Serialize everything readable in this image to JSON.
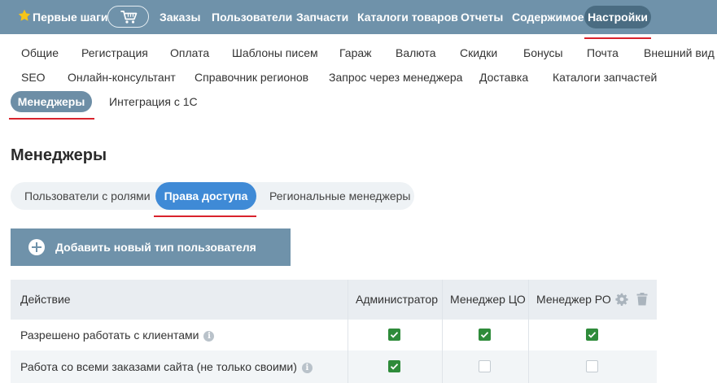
{
  "topnav": {
    "items": [
      {
        "label": "Первые шаги"
      },
      {
        "label": "Заказы"
      },
      {
        "label": "Пользователи"
      },
      {
        "label": "Запчасти"
      },
      {
        "label": "Каталоги товаров"
      },
      {
        "label": "Отчеты"
      },
      {
        "label": "Содержимое"
      },
      {
        "label": "Настройки"
      }
    ],
    "icons": [
      "star-icon",
      "cart-icon"
    ]
  },
  "settings_tabs": [
    {
      "label": "Общие"
    },
    {
      "label": "Регистрация"
    },
    {
      "label": "Оплата"
    },
    {
      "label": "Шаблоны писем"
    },
    {
      "label": "Гараж"
    },
    {
      "label": "Валюта"
    },
    {
      "label": "Скидки"
    },
    {
      "label": "Бонусы"
    },
    {
      "label": "Почта"
    },
    {
      "label": "Внешний вид"
    },
    {
      "label": "SEO"
    },
    {
      "label": "Онлайн-консультант"
    },
    {
      "label": "Справочник регионов"
    },
    {
      "label": "Запрос через менеджера"
    },
    {
      "label": "Доставка"
    },
    {
      "label": "Каталоги запчастей"
    },
    {
      "label": "Менеджеры"
    },
    {
      "label": "Интеграция с 1С"
    }
  ],
  "active_settings_tab": "Менеджеры",
  "page_title": "Менеджеры",
  "segment_tabs": [
    {
      "label": "Пользователи с ролями"
    },
    {
      "label": "Права доступа"
    },
    {
      "label": "Региональные менеджеры"
    }
  ],
  "active_segment_tab": "Права доступа",
  "add_button": {
    "label": "Добавить новый тип пользователя",
    "icon": "plus-circle-icon"
  },
  "table": {
    "columns": [
      {
        "label": "Действие"
      },
      {
        "label": "Администратор"
      },
      {
        "label": "Менеджер ЦО"
      },
      {
        "label": "Менеджер РО"
      }
    ],
    "column_icons": [
      "gear-icon",
      "trash-icon"
    ],
    "rows": [
      {
        "action": "Разрешено работать с клиентами",
        "info_icon": "i",
        "values": [
          true,
          true,
          true
        ]
      },
      {
        "action": "Работа со всеми заказами сайта (не только своими)",
        "info_icon": "i",
        "values": [
          true,
          false,
          false
        ]
      }
    ]
  },
  "colors": {
    "topbar": "#6f92aa",
    "topbar_active": "#4a6c82",
    "accent_blue": "#3f8ad6",
    "underline_red": "#d9232d",
    "checkbox_green": "#2e8b3a",
    "star_yellow": "#f5c518"
  }
}
